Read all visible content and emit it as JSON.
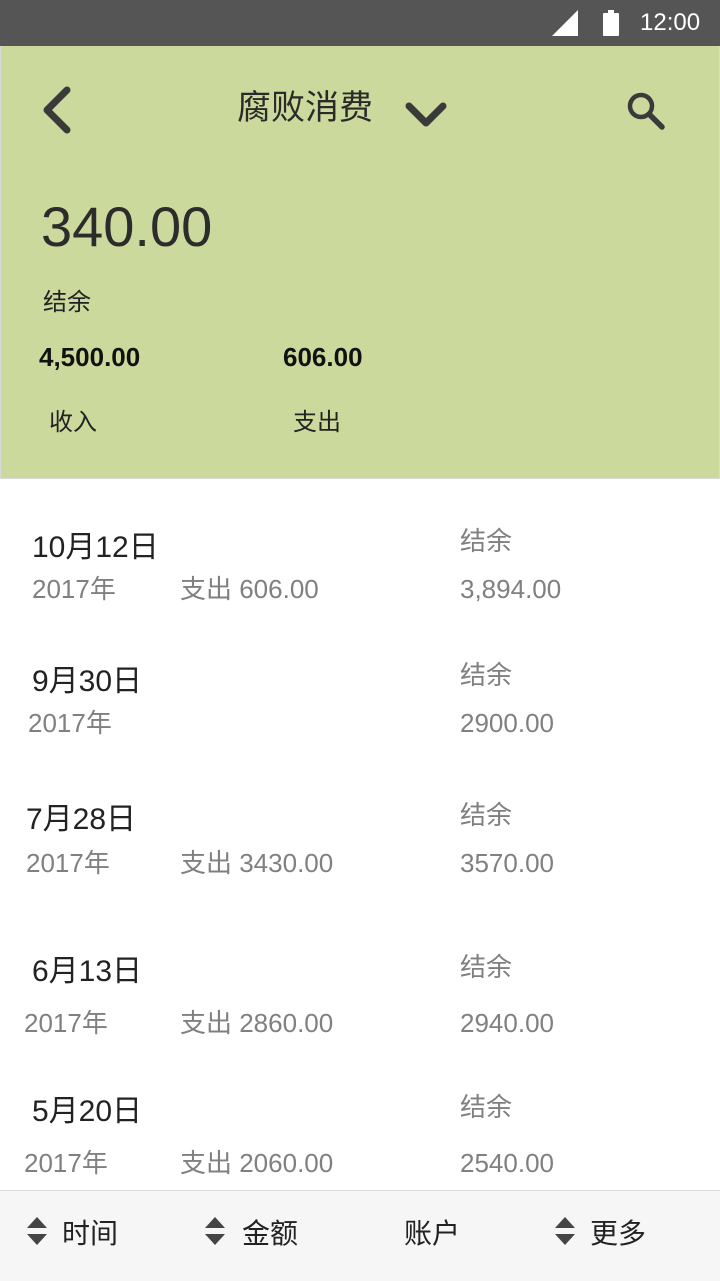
{
  "status_bar": {
    "time": "12:00"
  },
  "header": {
    "title": "腐败消费",
    "balance": "340.00",
    "balance_label": "结余",
    "income_value": "4,500.00",
    "expense_value": "606.00",
    "income_label": "收入",
    "expense_label": "支出"
  },
  "records": [
    {
      "date": "10月12日",
      "year": "2017年",
      "expense": "支出 606.00",
      "balance_label": "结余",
      "balance": "3,894.00"
    },
    {
      "date": "9月30日",
      "year": "2017年",
      "expense": "",
      "balance_label": "结余",
      "balance": "2900.00"
    },
    {
      "date": "7月28日",
      "year": "2017年",
      "expense": "支出 3430.00",
      "balance_label": "结余",
      "balance": "3570.00"
    },
    {
      "date": "6月13日",
      "year": "2017年",
      "expense": "支出 2860.00",
      "balance_label": "结余",
      "balance": "2940.00"
    },
    {
      "date": "5月20日",
      "year": "2017年",
      "expense": "支出 2060.00",
      "balance_label": "结余",
      "balance": "2540.00"
    }
  ],
  "bottom_bar": {
    "time_label": "时间",
    "amount_label": "金额",
    "account_label": "账户",
    "more_label": "更多"
  },
  "colors": {
    "status_bar": "#555555",
    "header_bg": "#cbd99c",
    "secondary_text": "#808080"
  }
}
